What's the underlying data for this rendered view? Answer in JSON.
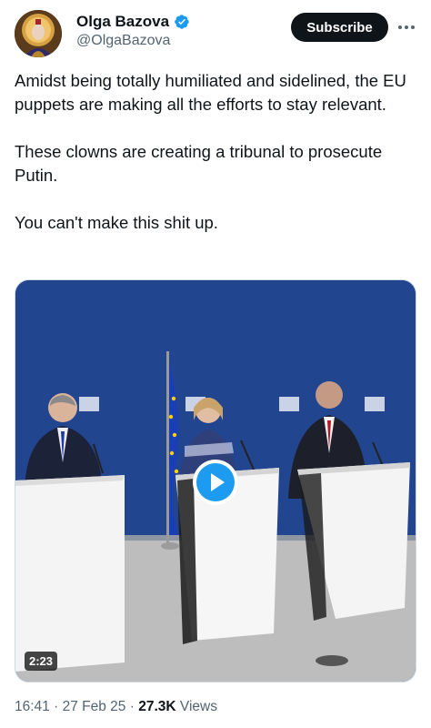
{
  "author": {
    "display_name": "Olga Bazova",
    "handle": "@OlgaBazova",
    "verified": true,
    "avatar_icon": "avatar-portrait"
  },
  "actions": {
    "subscribe_label": "Subscribe",
    "more_icon": "more-icon"
  },
  "tweet": {
    "paragraphs": [
      "Amidst being totally humiliated and sidelined, the EU puppets are making all the efforts to stay relevant.",
      "These clowns are creating a tribunal to prosecute Putin.",
      "You can't make this shit up."
    ]
  },
  "media": {
    "type": "video",
    "duration": "2:23",
    "play_icon": "play-icon"
  },
  "meta": {
    "time": "16:41",
    "date": "27 Feb 25",
    "separator": "·",
    "views_count": "27.3K",
    "views_label": "Views"
  },
  "colors": {
    "accent": "#1d9bf0",
    "text": "#0f1419",
    "secondary": "#536471",
    "backdrop": "#1f3f8f"
  }
}
